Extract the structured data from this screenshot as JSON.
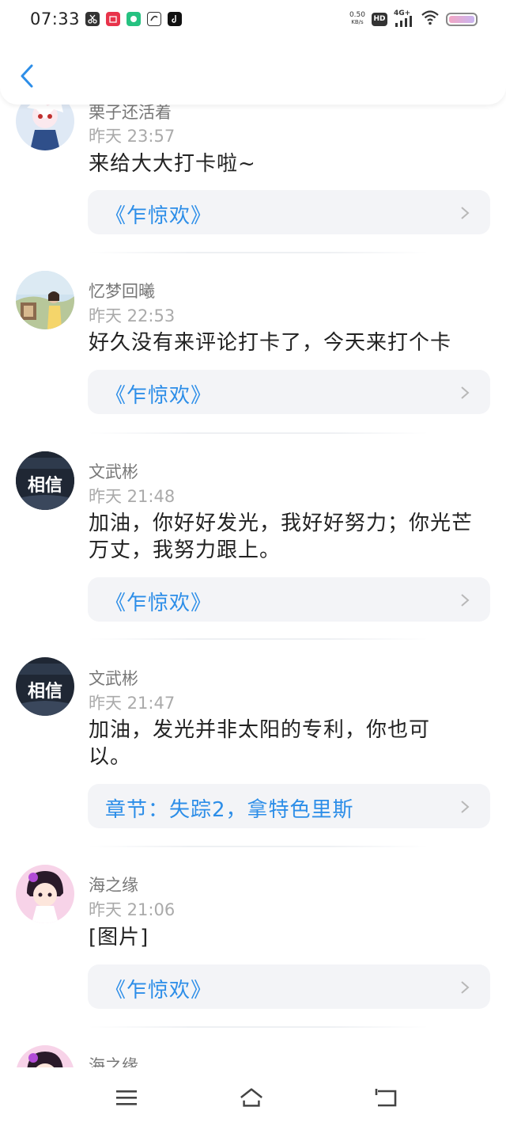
{
  "status_bar": {
    "time": "07:33",
    "net_speed_value": "0.50",
    "net_speed_unit": "KB/s",
    "hd": "HD",
    "network": "4G+",
    "notification_icons": [
      "scissors-app-icon",
      "shop-app-icon",
      "green-app-icon",
      "link-app-icon",
      "tiktok-icon"
    ]
  },
  "header": {
    "back_icon": "chevron-left-icon"
  },
  "comments": [
    {
      "author": "栗子还活着",
      "time": "昨天 23:57",
      "text": "来给大大打卡啦~",
      "source": "《乍惊欢》"
    },
    {
      "author": "忆梦回曦",
      "time": "昨天 22:53",
      "text": "好久没有来评论打卡了，今天来打个卡",
      "source": "《乍惊欢》"
    },
    {
      "author": "文武彬",
      "time": "昨天 21:48",
      "text": "加油，你好好发光，我好好努力；你光芒万丈，我努力跟上。",
      "source": "《乍惊欢》",
      "avatar_text": "相信"
    },
    {
      "author": "文武彬",
      "time": "昨天 21:47",
      "text": "加油，发光并非太阳的专利，你也可以。",
      "source": "章节：失踪2，拿特色里斯",
      "avatar_text": "相信"
    },
    {
      "author": "海之缘",
      "time": "昨天 21:06",
      "text": "[图片]",
      "source": "《乍惊欢》"
    },
    {
      "author": "海之缘"
    }
  ],
  "colors": {
    "accent": "#2d8ee8",
    "card_bg": "#f3f4f7",
    "meta_text": "#aaaaaa"
  },
  "nav_bar": {
    "icons": [
      "menu-icon",
      "home-icon",
      "back-icon"
    ]
  }
}
